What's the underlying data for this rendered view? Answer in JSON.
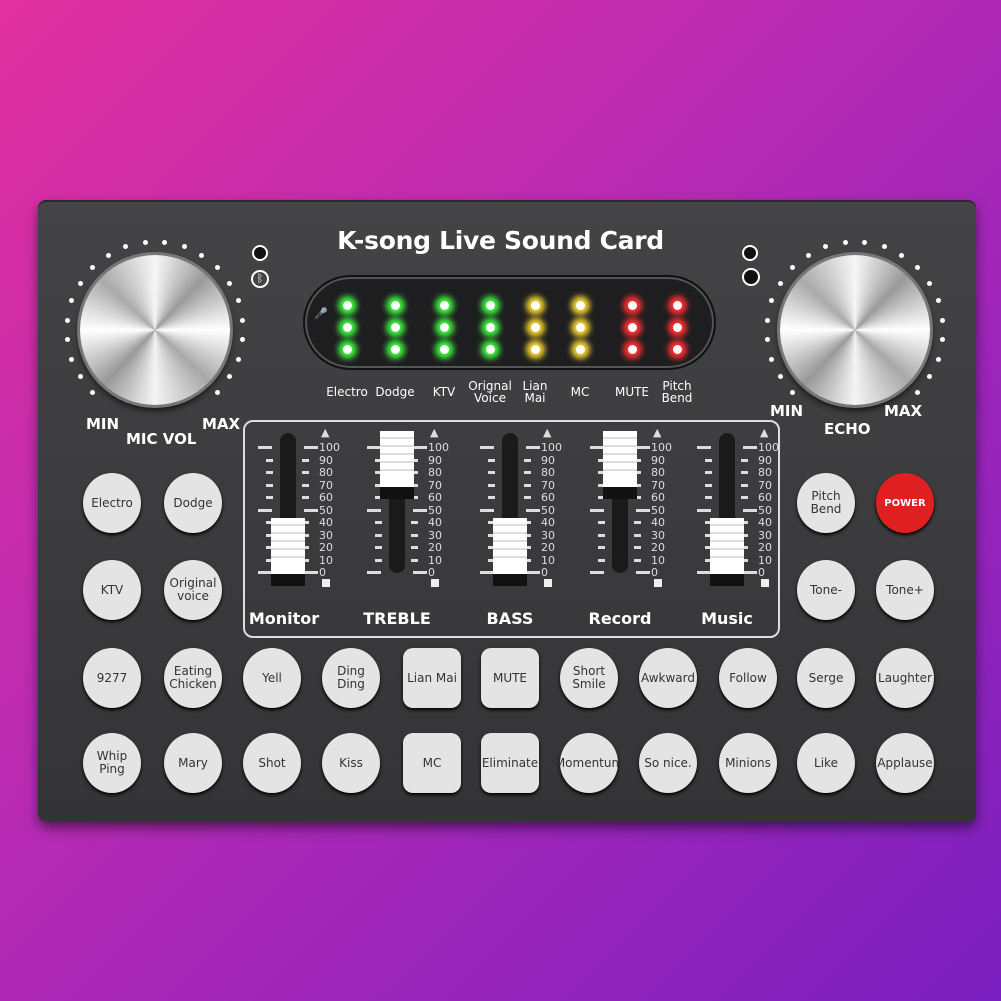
{
  "title": "K-song Live Sound Card",
  "colors": {
    "led_green": "#3ef03e",
    "led_yellow": "#f0d030",
    "led_red": "#ff3030",
    "power": "#e02020"
  },
  "leds": {
    "labels": [
      "Electro",
      "Dodge",
      "KTV",
      "Orignal Voice",
      "Lian Mai",
      "MC",
      "MUTE",
      "Pitch Bend"
    ],
    "colors": [
      "green",
      "green",
      "green",
      "green",
      "yellow",
      "yellow",
      "red",
      "red"
    ]
  },
  "left_knob": {
    "min": "MIN",
    "name": "MIC VOL",
    "max": "MAX"
  },
  "right_knob": {
    "min": "MIN",
    "name": "ECHO",
    "max": "MAX"
  },
  "icons": [
    "bluetooth-icon",
    "microphone-icon",
    "headphone-jack-icon"
  ],
  "scale": [
    "100",
    "90",
    "80",
    "70",
    "60",
    "50",
    "40",
    "30",
    "20",
    "10",
    "0"
  ],
  "faders": [
    {
      "label": "Monitor",
      "level": 15
    },
    {
      "label": "TREBLE",
      "level": 85
    },
    {
      "label": "BASS",
      "level": 15
    },
    {
      "label": "Record",
      "level": 85
    },
    {
      "label": "Music",
      "level": 15
    }
  ],
  "buttons": [
    [
      {
        "label": "Electro"
      },
      {
        "label": "Dodge"
      },
      null,
      null,
      null,
      null,
      null,
      null,
      null,
      {
        "label": "Pitch Bend"
      },
      {
        "label": "POWER",
        "type": "power"
      }
    ],
    [
      {
        "label": "KTV"
      },
      {
        "label": "Original voice"
      },
      null,
      null,
      null,
      null,
      null,
      null,
      null,
      {
        "label": "Tone-"
      },
      {
        "label": "Tone+"
      }
    ],
    [
      {
        "label": "9277"
      },
      {
        "label": "Eating Chicken"
      },
      {
        "label": "Yell"
      },
      {
        "label": "Ding Ding"
      },
      {
        "label": "Lian Mai",
        "type": "sq"
      },
      {
        "label": "MUTE",
        "type": "sq"
      },
      {
        "label": "Short Smile"
      },
      {
        "label": "Awkward"
      },
      {
        "label": "Follow"
      },
      {
        "label": "Serge"
      },
      {
        "label": "Laughter"
      }
    ],
    [
      {
        "label": "Whip Ping"
      },
      {
        "label": "Mary"
      },
      {
        "label": "Shot"
      },
      {
        "label": "Kiss"
      },
      {
        "label": "MC",
        "type": "sq"
      },
      {
        "label": "Eliminate",
        "type": "sq"
      },
      {
        "label": "Momentum"
      },
      {
        "label": "So nice."
      },
      {
        "label": "Minions"
      },
      {
        "label": "Like"
      },
      {
        "label": "Applause"
      }
    ]
  ]
}
